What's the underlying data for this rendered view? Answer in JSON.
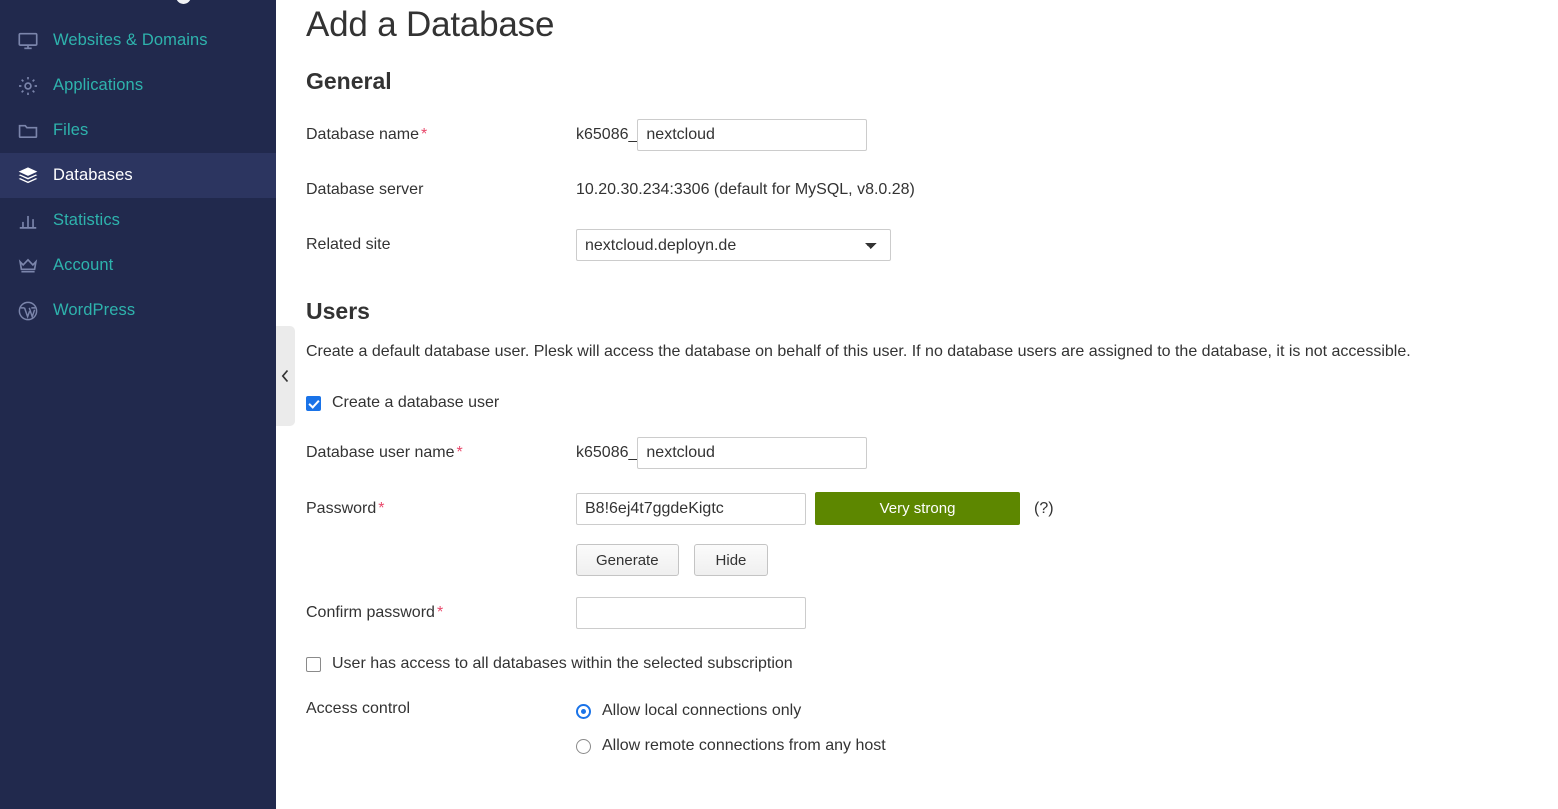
{
  "sidebar": {
    "items": [
      {
        "label": "Websites & Domains",
        "icon": "monitor-icon",
        "active": false
      },
      {
        "label": "Applications",
        "icon": "gear-icon",
        "active": false
      },
      {
        "label": "Files",
        "icon": "folder-icon",
        "active": false
      },
      {
        "label": "Databases",
        "icon": "layers-icon",
        "active": true
      },
      {
        "label": "Statistics",
        "icon": "bar-chart-icon",
        "active": false
      },
      {
        "label": "Account",
        "icon": "crown-icon",
        "active": false
      },
      {
        "label": "WordPress",
        "icon": "wordpress-icon",
        "active": false
      }
    ],
    "collapse_handle_icon": "chevron-left-icon",
    "background_color": "#21294d",
    "active_background_color": "#2c3560",
    "link_color": "#2eb3ad"
  },
  "page": {
    "title": "Add a Database"
  },
  "general": {
    "heading": "General",
    "database_name": {
      "label": "Database name",
      "required_marker": "*",
      "prefix": "k65086_",
      "value": "nextcloud",
      "placeholder": ""
    },
    "database_server": {
      "label": "Database server",
      "value": "10.20.30.234:3306 (default for MySQL, v8.0.28)"
    },
    "related_site": {
      "label": "Related site",
      "selected": "nextcloud.deployn.de",
      "options": [
        "nextcloud.deployn.de"
      ]
    }
  },
  "users": {
    "heading": "Users",
    "description": "Create a default database user. Plesk will access the database on behalf of this user. If no database users are assigned to the database, it is not accessible.",
    "create_user_checkbox": {
      "label": "Create a database user",
      "checked": true
    },
    "database_user_name": {
      "label": "Database user name",
      "required_marker": "*",
      "prefix": "k65086_",
      "value": "nextcloud",
      "placeholder": ""
    },
    "password": {
      "label": "Password",
      "required_marker": "*",
      "value": "B8!6ej4t7ggdeKigtc",
      "placeholder": "",
      "strength_label": "Very strong",
      "strength_color": "#5d8700",
      "hint": "(?)"
    },
    "generate_button": "Generate",
    "hide_button": "Hide",
    "confirm_password": {
      "label": "Confirm password",
      "required_marker": "*",
      "value": "",
      "placeholder": ""
    },
    "all_databases_checkbox": {
      "label": "User has access to all databases within the selected subscription",
      "checked": false
    },
    "access_control": {
      "label": "Access control",
      "options": [
        {
          "label": "Allow local connections only",
          "selected": true
        },
        {
          "label": "Allow remote connections from any host",
          "selected": false
        }
      ]
    }
  }
}
